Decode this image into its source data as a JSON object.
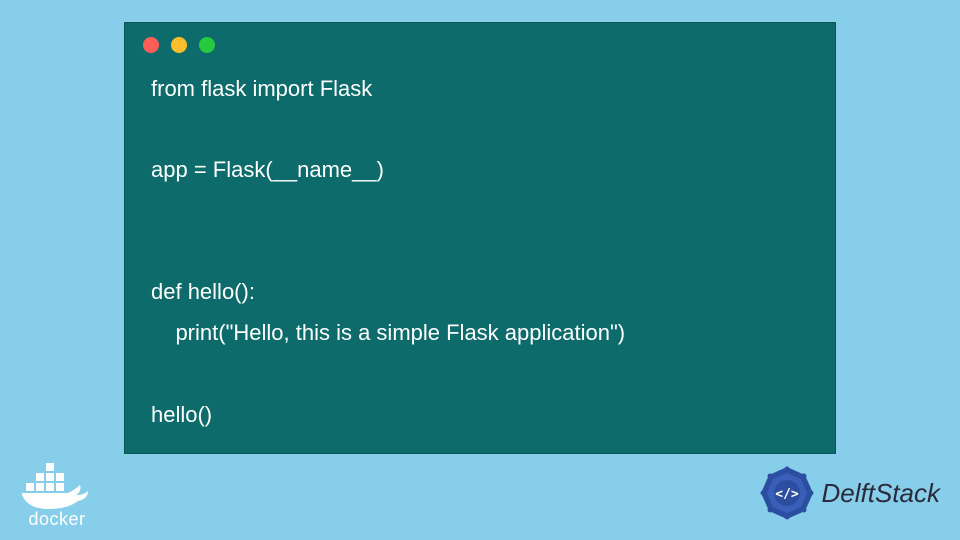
{
  "code": {
    "line1": "from flask import Flask",
    "line2": "",
    "line3": "app = Flask(__name__)",
    "line4": "",
    "line5": "",
    "line6": "def hello():",
    "line7": "    print(\"Hello, this is a simple Flask application\")",
    "line8": "",
    "line9": "hello()"
  },
  "logos": {
    "docker_label": "docker",
    "delftstack_label": "DelftStack"
  },
  "colors": {
    "background": "#87ceeb",
    "window_bg": "#0d6b6b",
    "dot_red": "#ff5f56",
    "dot_yellow": "#ffbd2e",
    "dot_green": "#27c93f",
    "code_text": "#ffffff",
    "docker_color": "#ffffff",
    "delftstack_badge": "#2b4ea0",
    "delftstack_text": "#2a2a3a"
  }
}
